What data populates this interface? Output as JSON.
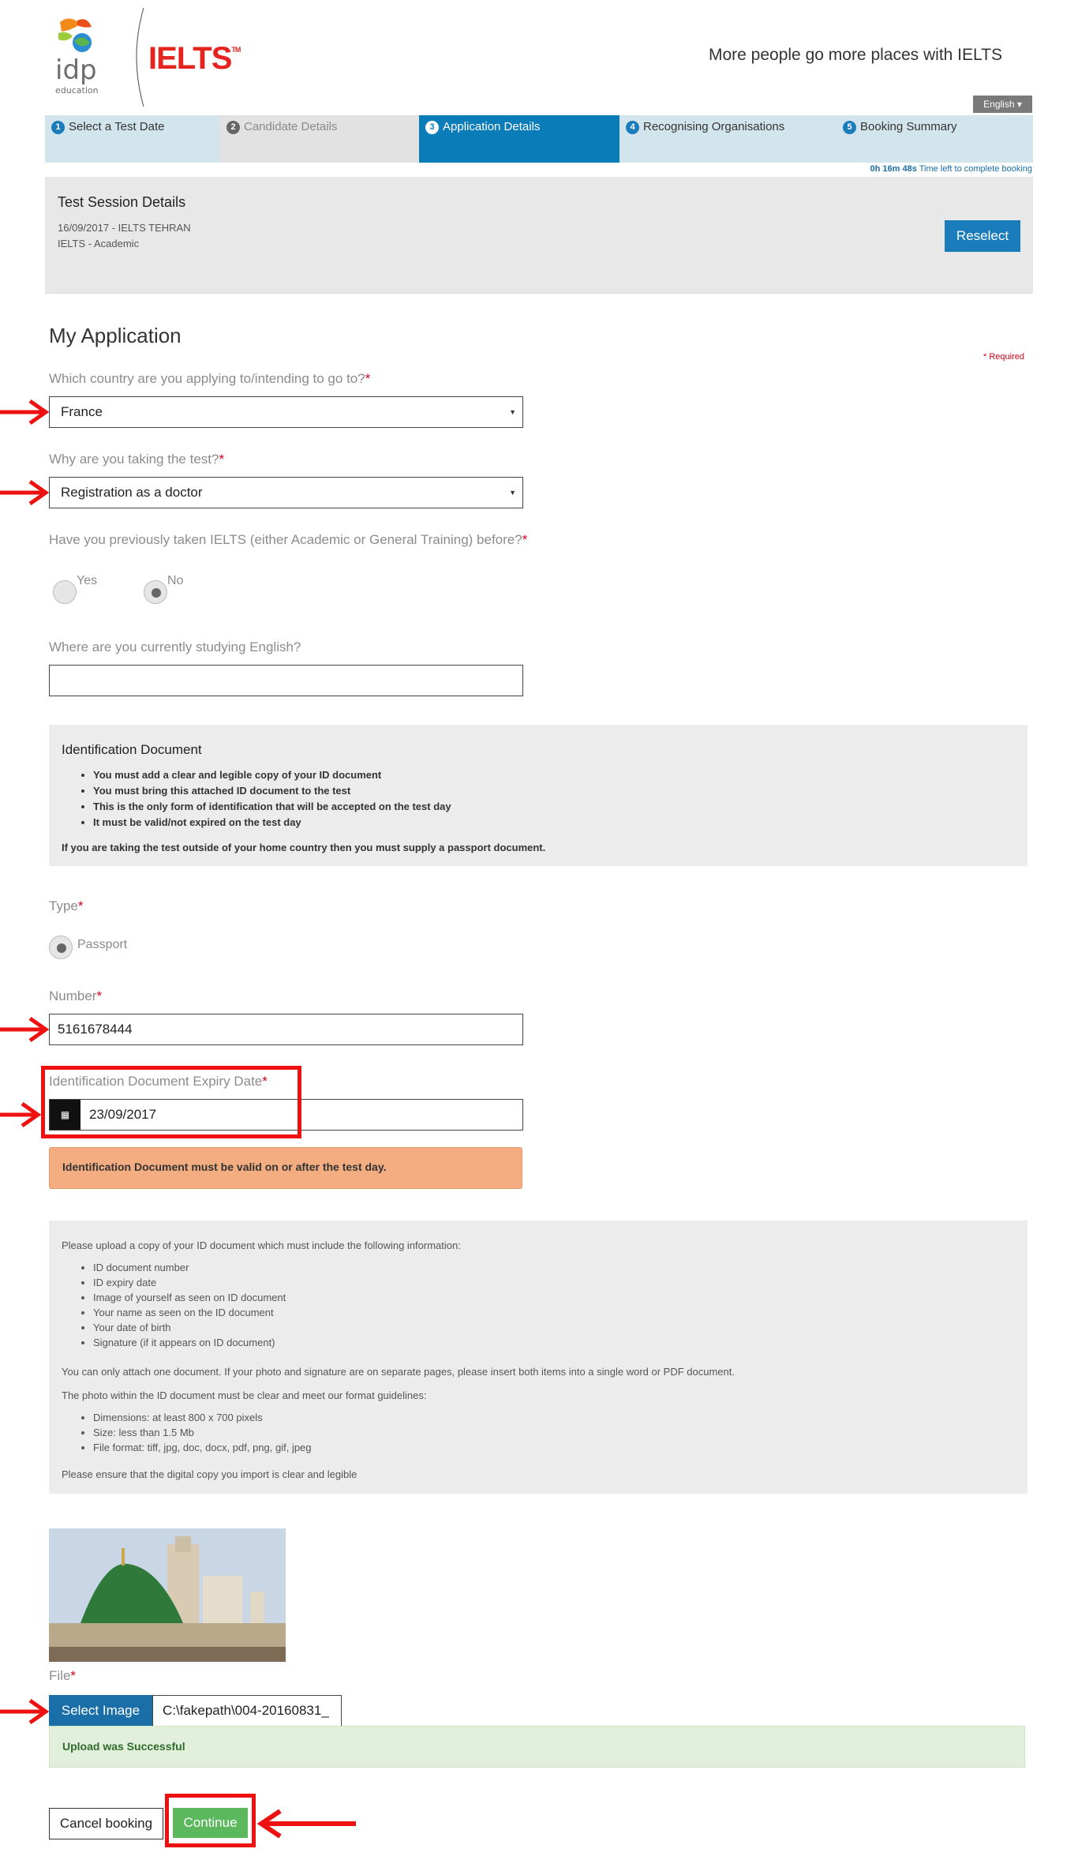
{
  "header": {
    "idp_logo_text": "idp",
    "idp_logo_sub": "education",
    "ielts_logo": "IELTS",
    "ielts_tm": "TM",
    "tagline": "More people go more places with IELTS",
    "language": "English ▾"
  },
  "steps": [
    {
      "num": "1",
      "label": "Select a Test Date",
      "state": "done"
    },
    {
      "num": "2",
      "label": "Candidate Details",
      "state": "inactive"
    },
    {
      "num": "3",
      "label": "Application Details",
      "state": "active"
    },
    {
      "num": "4",
      "label": "Recognising Organisations",
      "state": "todo"
    },
    {
      "num": "5",
      "label": "Booking Summary",
      "state": "todo"
    }
  ],
  "timer": {
    "value": "0h 16m 48s",
    "label": "Time left to complete booking"
  },
  "session": {
    "title": "Test Session Details",
    "line1": "16/09/2017 - IELTS TEHRAN",
    "line2": "IELTS - Academic",
    "reselect_label": "Reselect"
  },
  "application": {
    "heading": "My Application",
    "required_note": "* Required",
    "country_label": "Which country are you applying to/intending to go to?",
    "country_value": "France",
    "reason_label": "Why are you taking the test?",
    "reason_value": "Registration as a doctor",
    "previous_label": "Have you previously taken IELTS (either Academic or General Training) before?",
    "previous_yes": "Yes",
    "previous_no": "No",
    "studying_label": "Where are you currently studying English?",
    "studying_value": ""
  },
  "id_document": {
    "title": "Identification Document",
    "bullets": [
      "You must add a clear and legible copy of your ID document",
      "You must bring this attached ID document to the test",
      "This is the only form of identification that will be accepted on the test day",
      "It must be valid/not expired on the test day"
    ],
    "note": "If you are taking the test outside of your home country then you must supply a passport document."
  },
  "type": {
    "label": "Type",
    "option": "Passport"
  },
  "number": {
    "label": "Number",
    "value": "5161678444"
  },
  "expiry": {
    "label": "Identification Document Expiry Date",
    "value": "23/09/2017"
  },
  "warning": "Identification Document must be valid on or after the test day.",
  "upload_info": {
    "intro": "Please upload a copy of your ID document which must include the following information:",
    "items": [
      "ID document number",
      "ID expiry date",
      "Image of yourself as seen on ID document",
      "Your name as seen on the ID document",
      "Your date of birth",
      "Signature (if it appears on ID document)"
    ],
    "attach_note": "You can only attach one document. If your photo and signature are on separate pages, please insert both items into a single word or PDF document.",
    "photo_note": "The photo within the ID document must be clear and meet our format guidelines:",
    "format_items": [
      "Dimensions: at least 800 x 700 pixels",
      "Size: less than 1.5 Mb",
      "File format: tiff, jpg, doc, docx, pdf, png, gif, jpeg"
    ],
    "ensure_note": "Please ensure that the digital copy you import is clear and legible"
  },
  "file": {
    "label": "File",
    "select_label": "Select Image",
    "path": "C:\\fakepath\\004-20160831_",
    "success": "Upload was Successful"
  },
  "actions": {
    "cancel": "Cancel booking",
    "continue": "Continue"
  },
  "colors": {
    "brand_red": "#e52420",
    "primary_blue": "#1a7cba",
    "success_green": "#5cb85c",
    "annotation_red": "#ee1111"
  }
}
